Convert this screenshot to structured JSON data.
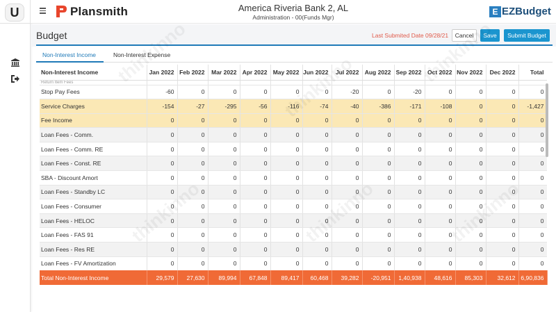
{
  "sidebar": {
    "logo_letter": "U",
    "icons": [
      "bank-icon",
      "sign-out-icon"
    ]
  },
  "topbar": {
    "brand": "Plansmith",
    "bank_name": "America Riveria Bank 2, AL",
    "sub_title": "Administration - 00(Funds Mgr)",
    "ez_logo": "EZBudget",
    "ez_logo_mark": "E"
  },
  "header": {
    "title": "Budget",
    "last_submitted": "Last Submited Date 09/28/21",
    "cancel_label": "Cancel",
    "save_label": "Save",
    "submit_label": "Submit Budget"
  },
  "tabs": [
    {
      "label": "Non-Interest Income",
      "active": true
    },
    {
      "label": "Non-Interest Expense",
      "active": false
    }
  ],
  "table": {
    "columns": [
      "Non-Interest Income",
      "Jan 2022",
      "Feb 2022",
      "Mar 2022",
      "Apr 2022",
      "May 2022",
      "Jun 2022",
      "Jul 2022",
      "Aug 2022",
      "Sep 2022",
      "Oct 2022",
      "Nov 2022",
      "Dec 2022",
      "Total"
    ],
    "partial_row": "Return Item Fees",
    "rows": [
      {
        "label": "Stop Pay Fees",
        "values": [
          "-60",
          "0",
          "0",
          "0",
          "0",
          "0",
          "-20",
          "0",
          "-20",
          "0",
          "0",
          "0",
          "0"
        ],
        "highlight": false
      },
      {
        "label": "Service Charges",
        "values": [
          "-154",
          "-27",
          "-295",
          "-56",
          "-116",
          "-74",
          "-40",
          "-386",
          "-171",
          "-108",
          "0",
          "0",
          "-1,427"
        ],
        "highlight": true
      },
      {
        "label": "Fee Income",
        "values": [
          "0",
          "0",
          "0",
          "0",
          "0",
          "0",
          "0",
          "0",
          "0",
          "0",
          "0",
          "0",
          "0"
        ],
        "highlight": true
      },
      {
        "label": "Loan Fees - Comm.",
        "values": [
          "0",
          "0",
          "0",
          "0",
          "0",
          "0",
          "0",
          "0",
          "0",
          "0",
          "0",
          "0",
          "0"
        ],
        "highlight": false
      },
      {
        "label": "Loan Fees - Comm. RE",
        "values": [
          "0",
          "0",
          "0",
          "0",
          "0",
          "0",
          "0",
          "0",
          "0",
          "0",
          "0",
          "0",
          "0"
        ],
        "highlight": false
      },
      {
        "label": "Loan Fees - Const. RE",
        "values": [
          "0",
          "0",
          "0",
          "0",
          "0",
          "0",
          "0",
          "0",
          "0",
          "0",
          "0",
          "0",
          "0"
        ],
        "highlight": false
      },
      {
        "label": "SBA - Discount Amort",
        "values": [
          "0",
          "0",
          "0",
          "0",
          "0",
          "0",
          "0",
          "0",
          "0",
          "0",
          "0",
          "0",
          "0"
        ],
        "highlight": false
      },
      {
        "label": "Loan Fees - Standby LC",
        "values": [
          "0",
          "0",
          "0",
          "0",
          "0",
          "0",
          "0",
          "0",
          "0",
          "0",
          "0",
          "0",
          "0"
        ],
        "highlight": false
      },
      {
        "label": "Loan Fees - Consumer",
        "values": [
          "0",
          "0",
          "0",
          "0",
          "0",
          "0",
          "0",
          "0",
          "0",
          "0",
          "0",
          "0",
          "0"
        ],
        "highlight": false
      },
      {
        "label": "Loan Fees - HELOC",
        "values": [
          "0",
          "0",
          "0",
          "0",
          "0",
          "0",
          "0",
          "0",
          "0",
          "0",
          "0",
          "0",
          "0"
        ],
        "highlight": false
      },
      {
        "label": "Loan Fees - FAS 91",
        "values": [
          "0",
          "0",
          "0",
          "0",
          "0",
          "0",
          "0",
          "0",
          "0",
          "0",
          "0",
          "0",
          "0"
        ],
        "highlight": false
      },
      {
        "label": "Loan Fees - Res RE",
        "values": [
          "0",
          "0",
          "0",
          "0",
          "0",
          "0",
          "0",
          "0",
          "0",
          "0",
          "0",
          "0",
          "0"
        ],
        "highlight": false
      },
      {
        "label": "Loan Fees - FV Amortization",
        "values": [
          "0",
          "0",
          "0",
          "0",
          "0",
          "0",
          "0",
          "0",
          "0",
          "0",
          "0",
          "0",
          "0"
        ],
        "highlight": false
      }
    ],
    "total": {
      "label": "Total Non-Interest Income",
      "values": [
        "29,579",
        "27,630",
        "89,994",
        "67,848",
        "89,417",
        "60,468",
        "39,282",
        "-20,951",
        "1,40,938",
        "48,616",
        "85,303",
        "32,612",
        "6,90,836"
      ]
    }
  },
  "colors": {
    "accent": "#1f7ab8",
    "button": "#1b95cf",
    "highlight_row": "#fbe8b5",
    "total_row": "#f06a36",
    "last_submitted": "#e05a4a"
  }
}
